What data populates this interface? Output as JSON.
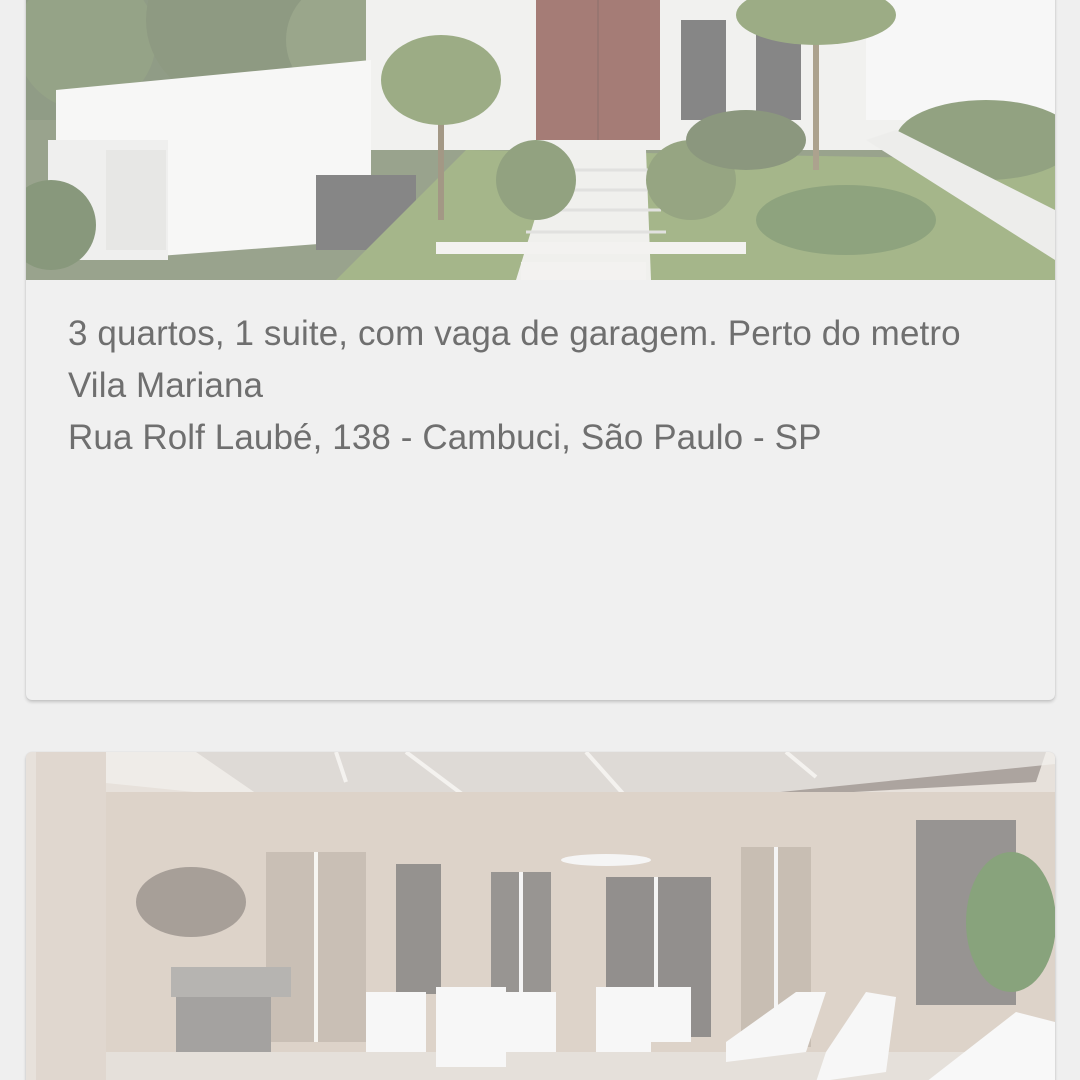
{
  "listings": [
    {
      "photo_alt": "house-front-garden-photo",
      "description": "3 quartos, 1 suite, com vaga de garagem. Perto do metro Vila Mariana",
      "address": "Rua Rolf Laubé, 138 - Cambuci, São Paulo - SP"
    },
    {
      "photo_alt": "covered-patio-photo"
    }
  ],
  "colors": {
    "background": "#efefef",
    "card": "#f0f0f0",
    "text": "#6f6f6f"
  }
}
